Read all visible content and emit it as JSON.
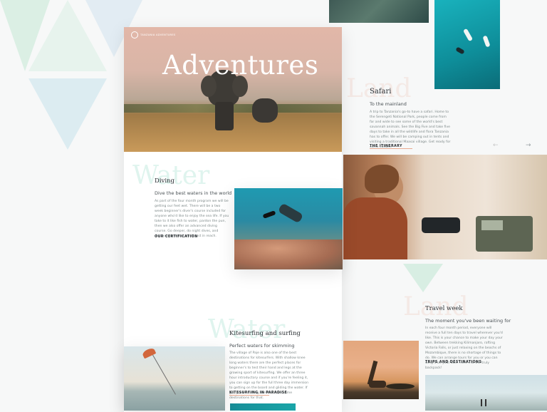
{
  "hero": {
    "brand": "TANZANIA ADVENTURES",
    "title": "Adventures"
  },
  "safari": {
    "ghost": "Land",
    "title": "Safari",
    "subtitle": "To the mainland",
    "body": "A trip to Tanzania's go-to have a safari. Home to the Serengeti National Park, people come from far and wide to see some of the world's best savannah animals. See the Big Five and take five days to take in all the wildlife and flora Tanzania has to offer. We will be camping out in tents and visiting a traditional Maasai village. Get ready for some culture.",
    "link": "THE ITINERARY"
  },
  "diving": {
    "ghost": "Water",
    "title": "Diving",
    "subtitle": "Dive the best waters in the world",
    "body": "As part of the four month program we will be getting our feet wet. There will be a two week beginner's diver's course included for anyone who'd like to enjoy the sea life. If you take to it like fish to water, pardon the pun, then we also offer an advanced diving course. Go deeper, do night dives, and discover an entire world just in reach.",
    "link": "OUR CERTIFICATION"
  },
  "kite": {
    "ghost": "Water",
    "title": "Kitesurfing and surfing",
    "subtitle": "Perfect waters for skimming",
    "body": "The village of Paje is also one of the best destinations for kitesurfers. With shallow knee long waters there are the perfect places for beginner's to test their hand and legs at the growing sport of kitesurfing. We offer an three hour introductory course and if you're feeling it, you can sign up for the full three day immersion to getting on the board and gliding the water. If you prefer surfing, we also have some destinations for that.",
    "link": "KITESURFING IN PARADISE"
  },
  "travel": {
    "ghost": "Land",
    "title": "Travel week",
    "subtitle": "The moment you've been waiting for",
    "body": "In each four month period, everyone will receive a full ten days to travel wherever you'd like. This is your chance to make your day your own. Between trekking Kilimanjaro, rafting Victoria Falls, or just relaxing on the beachs of Mozambique, there is no shortage of things to do. We can arrange tours for you or you can wing it on your own. Here's to the truly backpack!",
    "link": "TRIPS AND DESTINATIONS"
  },
  "nav": {
    "prev": "←",
    "next": "→"
  },
  "icons": [
    "logo-icon",
    "arrow-left-icon",
    "arrow-right-icon"
  ],
  "colors": {
    "accent": "#e8a98f",
    "mint": "#b7e7d9",
    "text": "#2b3034"
  }
}
